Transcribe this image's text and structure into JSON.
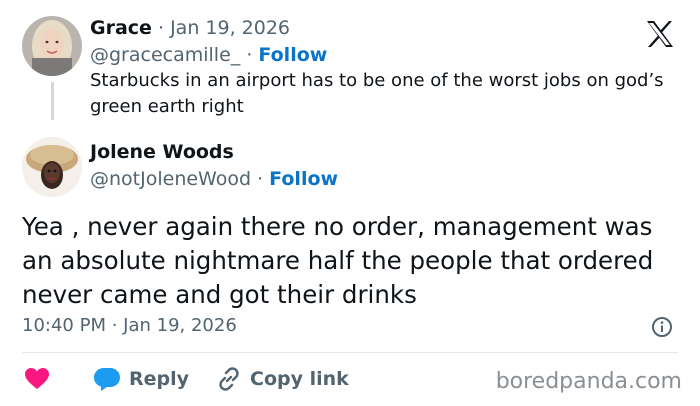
{
  "original_post": {
    "name": "Grace",
    "separator": "·",
    "date": "Jan 19, 2026",
    "handle": "@gracecamille_",
    "follow_label": "Follow",
    "text": "Starbucks in an airport has to be one of the worst jobs on god’s green earth right"
  },
  "reply": {
    "name": "Jolene Woods",
    "handle": "@notJoleneWood",
    "separator": "·",
    "follow_label": "Follow",
    "text": "Yea , never again there no order, management was an absolute nightmare half the people that ordered never came and got their drinks",
    "timestamp": "10:40 PM · Jan 19, 2026"
  },
  "actions": {
    "reply_label": "Reply",
    "copy_link_label": "Copy link"
  },
  "watermark": "boredpanda.com",
  "colors": {
    "like": "#f91880",
    "reply": "#1d9bf0",
    "follow": "#0a74c8",
    "muted": "#536471"
  },
  "icons": [
    "x-logo-icon",
    "heart-icon",
    "reply-bubble-icon",
    "link-icon",
    "info-icon"
  ]
}
